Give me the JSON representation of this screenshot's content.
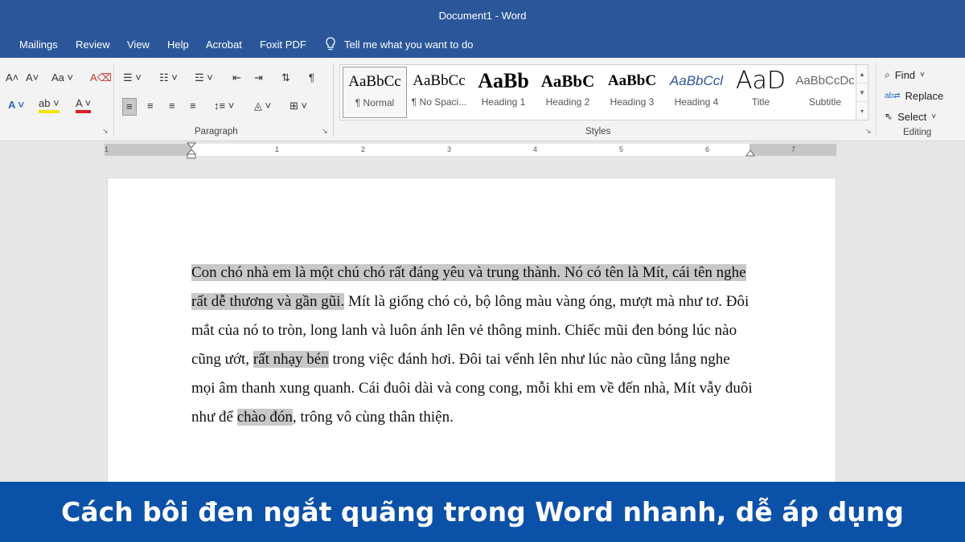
{
  "window": {
    "title": "Document1  -  Word"
  },
  "menu_tabs": [
    "Mailings",
    "Review",
    "View",
    "Help",
    "Acrobat",
    "Foxit PDF"
  ],
  "tell_me": "Tell me what you want to do",
  "ribbon": {
    "paragraph_label": "Paragraph",
    "styles_label": "Styles",
    "editing_label": "Editing",
    "styles": [
      {
        "preview": "AaBbCc",
        "name": "¶ Normal"
      },
      {
        "preview": "AaBbCc",
        "name": "¶ No Spaci..."
      },
      {
        "preview": "AaBb",
        "name": "Heading 1"
      },
      {
        "preview": "AaBbC",
        "name": "Heading 2"
      },
      {
        "preview": "AaBbC",
        "name": "Heading 3"
      },
      {
        "preview": "AaBbCcl",
        "name": "Heading 4"
      },
      {
        "preview": "AaD",
        "name": "Title"
      },
      {
        "preview": "AaBbCcDc",
        "name": "Subtitle"
      }
    ],
    "editing": {
      "find": "Find",
      "replace": "Replace",
      "select": "Select"
    }
  },
  "ruler": {
    "ticks": [
      "1",
      "1",
      "2",
      "3",
      "4",
      "5",
      "6",
      "7"
    ]
  },
  "document": {
    "segments": [
      {
        "text": "Con chó nhà em là một chú chó rất đáng yêu và trung thành. Nó có tên là Mít, cái tên nghe rất dễ thương và gần gũi.",
        "highlighted": true
      },
      {
        "text": " Mít là giống chó cỏ, bộ lông màu vàng óng, mượt mà như tơ. Đôi mắt của nó to tròn, long lanh và luôn ánh lên vẻ thông minh. Chiếc mũi đen bóng lúc nào cũng ướt, ",
        "highlighted": false
      },
      {
        "text": "rất nhạy bén",
        "highlighted": true
      },
      {
        "text": " trong việc đánh hơi. Đôi tai vểnh lên như lúc nào cũng lắng nghe mọi âm thanh xung quanh. Cái đuôi dài và cong cong, mỗi khi em về đến nhà, Mít vẫy đuôi như để ",
        "highlighted": false
      },
      {
        "text": "chào đón",
        "highlighted": true
      },
      {
        "text": ", trông vô cùng thân thiện.",
        "highlighted": false
      }
    ]
  },
  "banner": {
    "text": "Cách bôi đen ngắt quãng trong Word nhanh, dễ áp dụng"
  },
  "colors": {
    "title_bar": "#2b579a",
    "banner": "#0b51a8",
    "highlight": "#c8c8c8"
  }
}
